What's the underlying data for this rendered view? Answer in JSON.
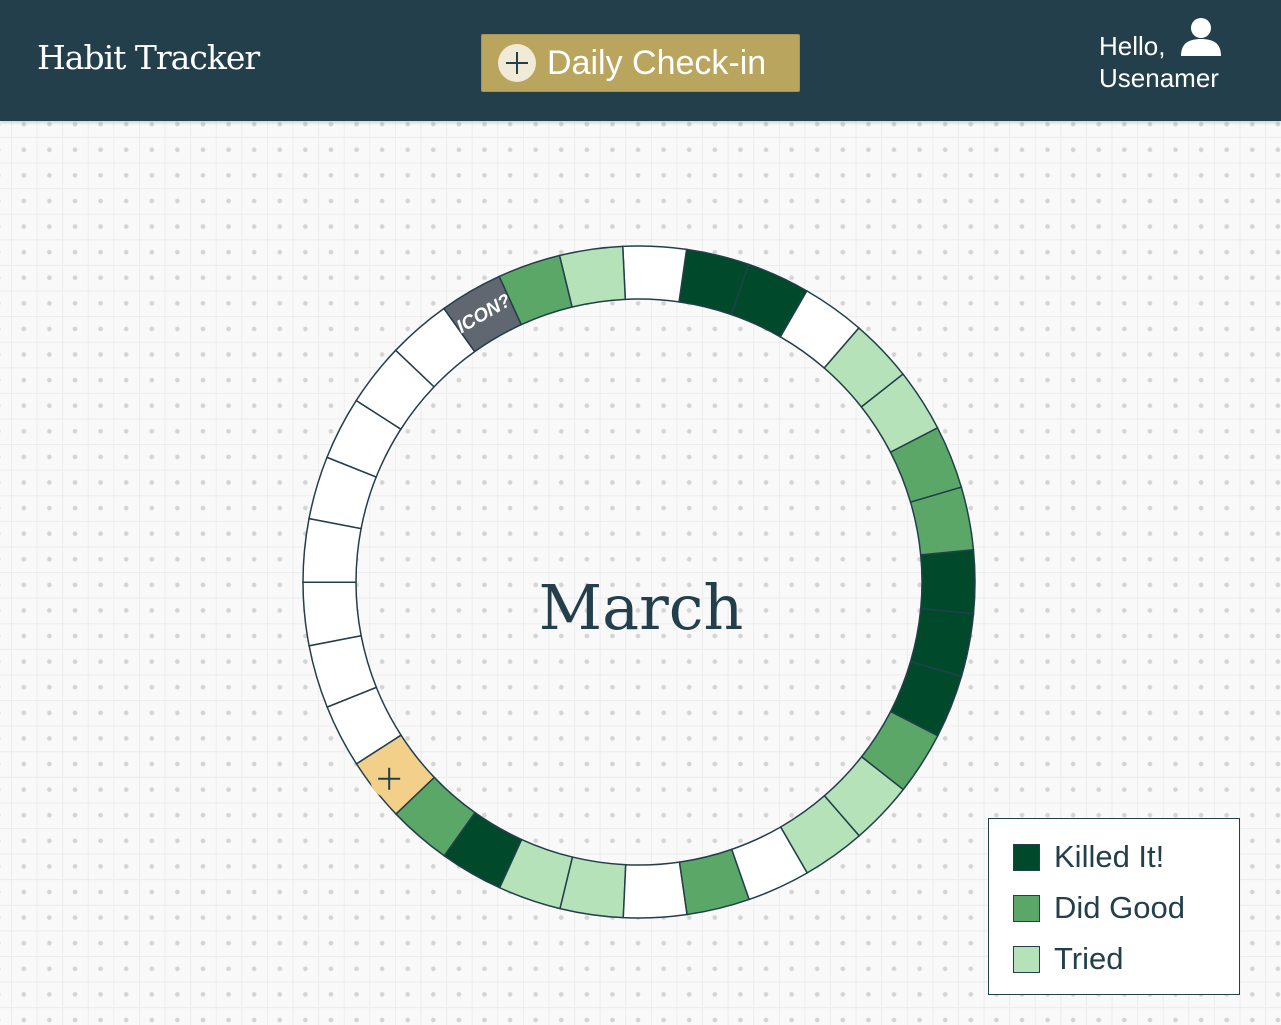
{
  "header": {
    "title": "Habit Tracker",
    "checkin_label": "Daily Check-in",
    "greeting_line1": "Hello,",
    "username": "Usenamer",
    "icons": {
      "checkin": "plus-circle-icon",
      "user": "user-icon"
    }
  },
  "tracker": {
    "month": "March",
    "habit_icon_placeholder": "ICON?",
    "days": [
      "empty",
      "empty",
      "empty",
      "empty",
      "empty",
      "empty",
      "empty",
      "empty",
      "add",
      "did_good",
      "killed_it",
      "tried",
      "tried",
      "empty",
      "did_good",
      "empty",
      "tried",
      "tried",
      "did_good",
      "killed_it",
      "killed_it",
      "killed_it",
      "did_good",
      "did_good",
      "tried",
      "tried",
      "empty",
      "killed_it",
      "killed_it",
      "empty",
      "tried",
      "did_good",
      "habit"
    ],
    "colors": {
      "killed_it": "#004a2b",
      "did_good": "#5ba767",
      "tried": "#b5e2b9",
      "empty": "#ffffff",
      "habit": "#606770",
      "add": "#f2d08a",
      "outline": "#223f4b"
    }
  },
  "legend": {
    "items": [
      {
        "label": "Killed It!",
        "color": "#004a2b"
      },
      {
        "label": "Did Good",
        "color": "#5ba767"
      },
      {
        "label": "Tried",
        "color": "#b5e2b9"
      }
    ]
  }
}
